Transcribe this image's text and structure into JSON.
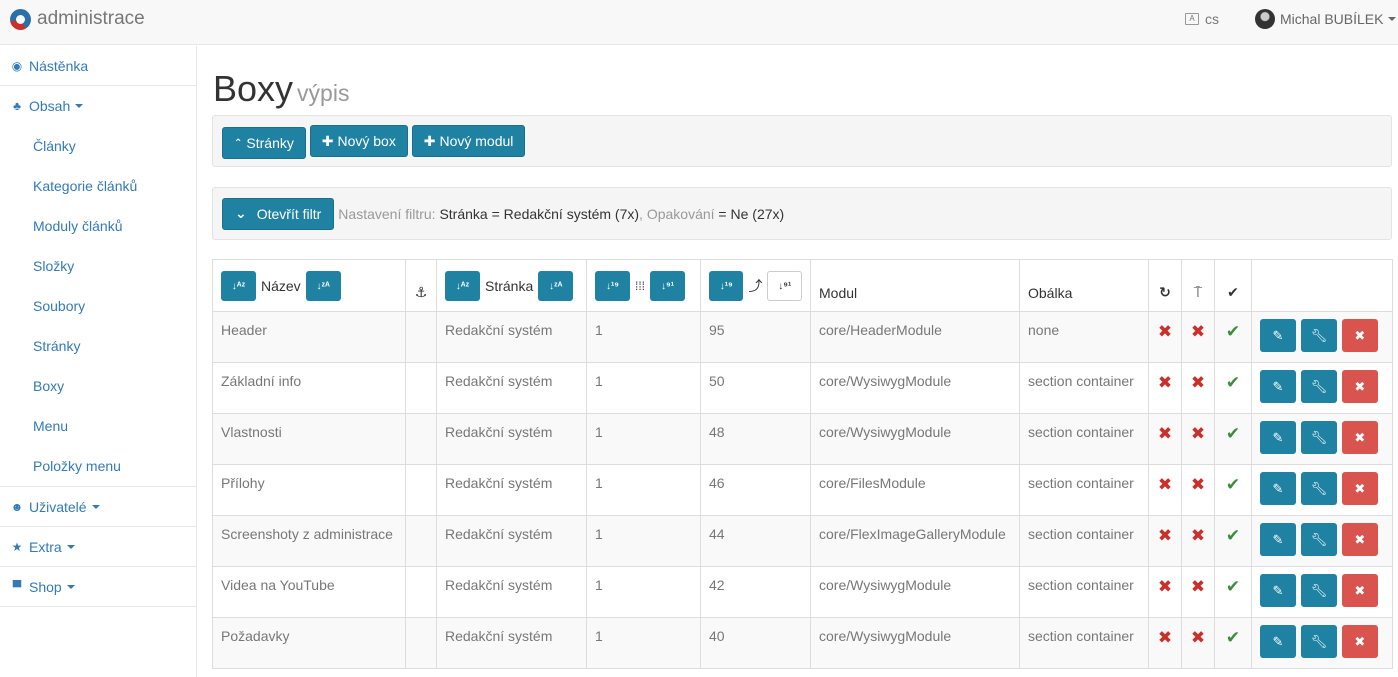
{
  "navbar": {
    "brand": "administrace",
    "lang": "cs",
    "user": "Michal BUBÍLEK"
  },
  "sidebar": {
    "dashboard": "Nástěnka",
    "content": "Obsah",
    "content_items": [
      "Články",
      "Kategorie článků",
      "Moduly článků",
      "Složky",
      "Soubory",
      "Stránky",
      "Boxy",
      "Menu",
      "Položky menu"
    ],
    "users": "Uživatelé",
    "extra": "Extra",
    "shop": "Shop"
  },
  "page": {
    "title": "Boxy",
    "subtitle": "výpis"
  },
  "toolbar": {
    "pages": "Stránky",
    "new_box": "Nový box",
    "new_module": "Nový modul"
  },
  "filter": {
    "open": "Otevřít filtr",
    "prefix": "Nastavení filtru: ",
    "k1": "Stránka",
    "eq": " = ",
    "v1": "Redakční systém (7x)",
    "sep": ", ",
    "k2": "Opakování",
    "v2": "Ne (27x)"
  },
  "table": {
    "headers": {
      "name": "Název",
      "page": "Stránka",
      "module": "Modul",
      "wrapper": "Obálka"
    },
    "rows": [
      {
        "name": "Header",
        "page": "Redakční systém",
        "col3": "1",
        "col4": "95",
        "module": "core/HeaderModule",
        "wrapper": "none"
      },
      {
        "name": "Základní info",
        "page": "Redakční systém",
        "col3": "1",
        "col4": "50",
        "module": "core/WysiwygModule",
        "wrapper": "section container"
      },
      {
        "name": "Vlastnosti",
        "page": "Redakční systém",
        "col3": "1",
        "col4": "48",
        "module": "core/WysiwygModule",
        "wrapper": "section container"
      },
      {
        "name": "Přílohy",
        "page": "Redakční systém",
        "col3": "1",
        "col4": "46",
        "module": "core/FilesModule",
        "wrapper": "section container"
      },
      {
        "name": "Screenshoty z administrace",
        "page": "Redakční systém",
        "col3": "1",
        "col4": "44",
        "module": "core/FlexImageGalleryModule",
        "wrapper": "section container"
      },
      {
        "name": "Videa na YouTube",
        "page": "Redakční systém",
        "col3": "1",
        "col4": "42",
        "module": "core/WysiwygModule",
        "wrapper": "section container"
      },
      {
        "name": "Požadavky",
        "page": "Redakční systém",
        "col3": "1",
        "col4": "40",
        "module": "core/WysiwygModule",
        "wrapper": "section container"
      }
    ]
  },
  "colors": {
    "primary": "#1f82a2",
    "danger": "#d9534f",
    "link": "#337ab7",
    "success": "#3c8d3c"
  }
}
